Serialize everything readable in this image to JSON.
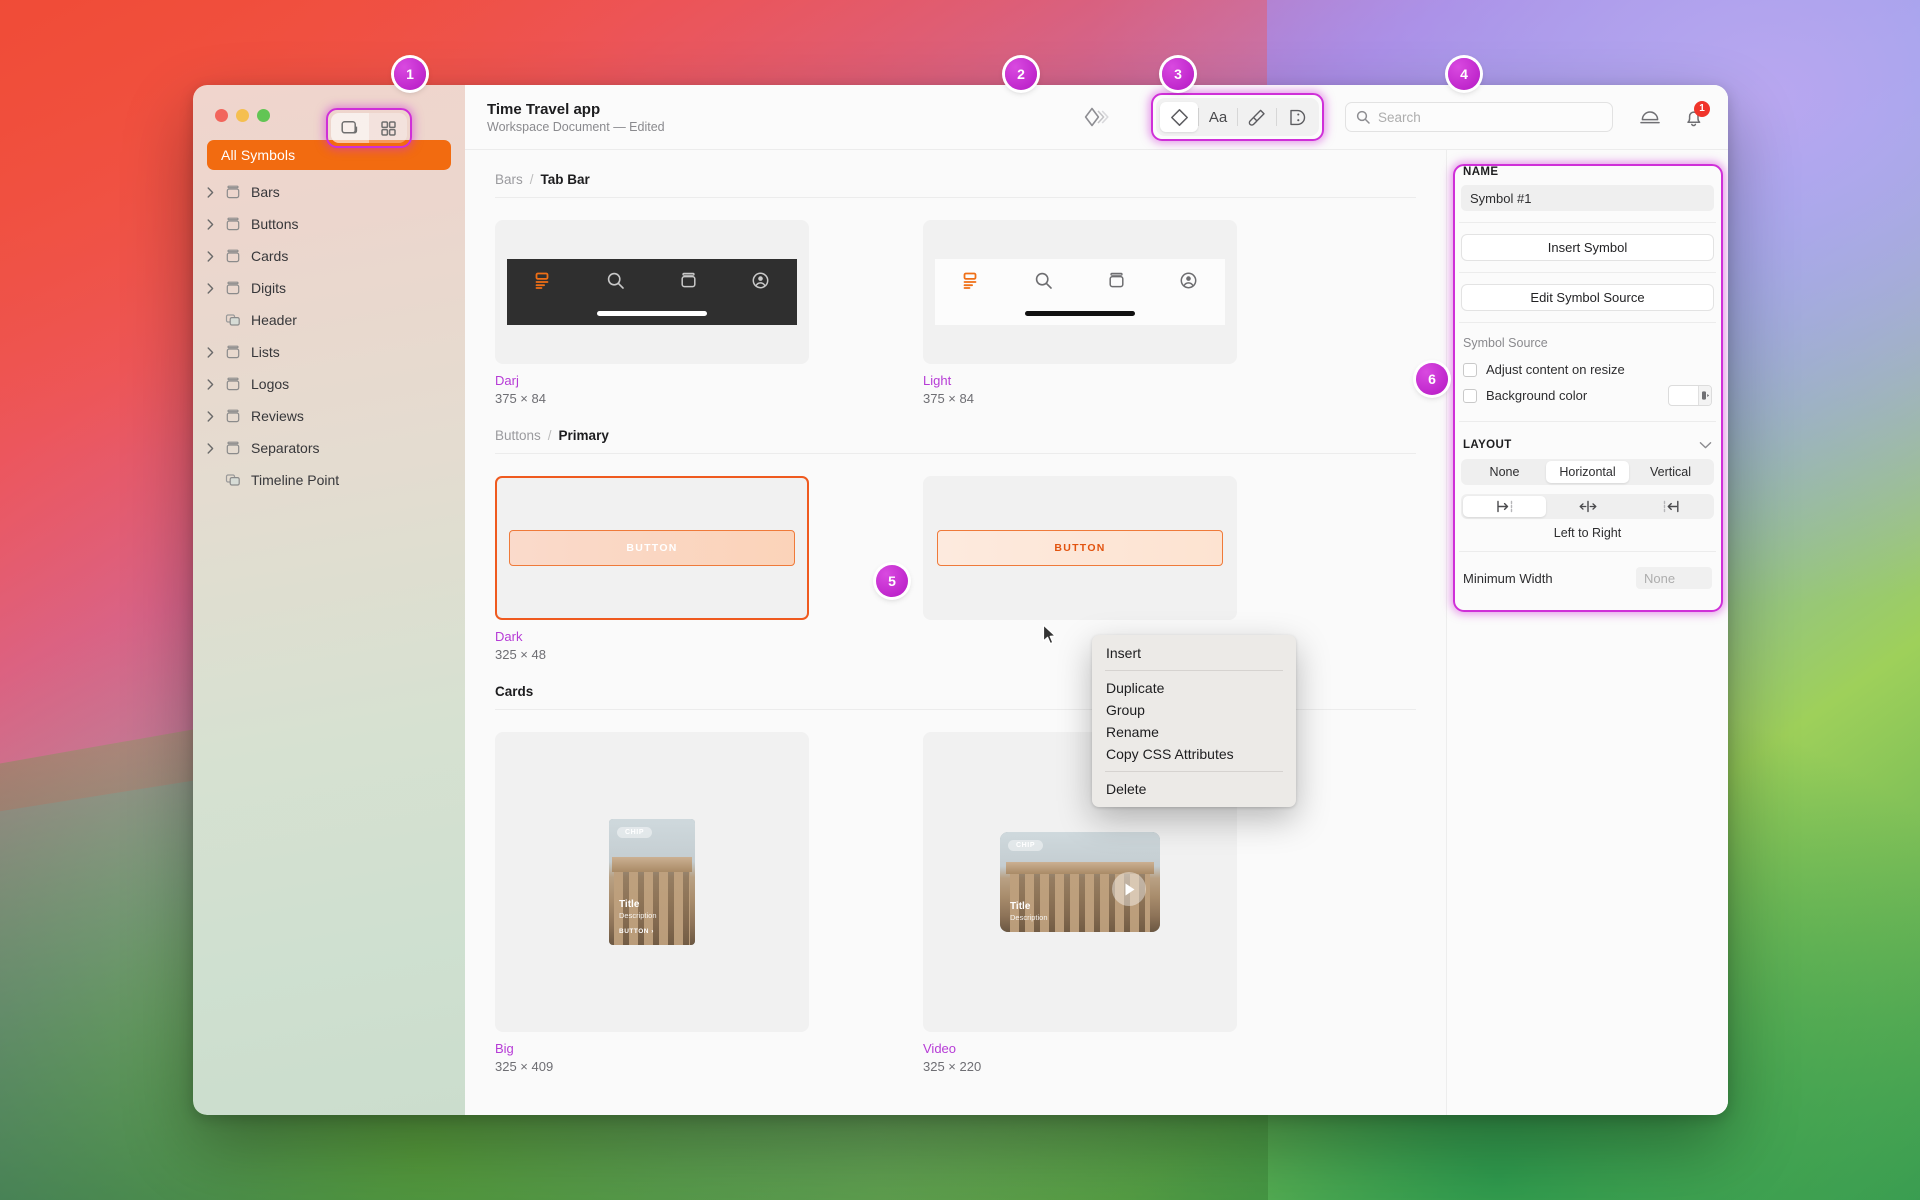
{
  "window": {
    "traffic_lights": [
      "close",
      "minimize",
      "zoom"
    ],
    "view_toggle": {
      "single_label": "single-view",
      "grid_label": "grid-view"
    }
  },
  "sidebar": {
    "all_symbols_label": "All Symbols",
    "items": [
      {
        "label": "Bars",
        "expandable": true,
        "icon": "library-icon"
      },
      {
        "label": "Buttons",
        "expandable": true,
        "icon": "library-icon"
      },
      {
        "label": "Cards",
        "expandable": true,
        "icon": "library-icon"
      },
      {
        "label": "Digits",
        "expandable": true,
        "icon": "library-icon"
      },
      {
        "label": "Header",
        "expandable": false,
        "icon": "symbol-icon"
      },
      {
        "label": "Lists",
        "expandable": true,
        "icon": "library-icon"
      },
      {
        "label": "Logos",
        "expandable": true,
        "icon": "library-icon"
      },
      {
        "label": "Reviews",
        "expandable": true,
        "icon": "library-icon"
      },
      {
        "label": "Separators",
        "expandable": true,
        "icon": "library-icon"
      },
      {
        "label": "Timeline Point",
        "expandable": false,
        "icon": "symbol-icon"
      }
    ]
  },
  "toolbar": {
    "doc_title": "Time Travel app",
    "doc_subtitle": "Workspace Document — Edited",
    "symbol_export_icon": "symbol-export-icon",
    "inspector_tabs": [
      {
        "name": "symbol-tab",
        "icon": "diamond-icon",
        "active": true
      },
      {
        "name": "text-tab",
        "icon": "text-aa-icon",
        "label": "Aa",
        "active": false
      },
      {
        "name": "style-tab",
        "icon": "paintbrush-icon",
        "active": false
      },
      {
        "name": "palette-tab",
        "icon": "color-palette-icon",
        "active": false
      }
    ],
    "search": {
      "placeholder": "Search",
      "value": ""
    },
    "share_icon": "share-dome-icon",
    "notifications": {
      "icon": "bell-icon",
      "count": "1"
    }
  },
  "canvas": {
    "sections": [
      {
        "breadcrumb": {
          "parent": "Bars",
          "separator": "/",
          "current": "Tab Bar"
        },
        "items": [
          {
            "name": "Darj",
            "size": "375 × 84",
            "kind": "tabbar",
            "theme": "dark",
            "tab_icons": [
              "dashboard-icon",
              "search-icon",
              "archive-icon",
              "account-icon"
            ],
            "active_tab_index": 0
          },
          {
            "name": "Light",
            "size": "375 × 84",
            "kind": "tabbar",
            "theme": "light",
            "tab_icons": [
              "dashboard-icon",
              "search-icon",
              "archive-icon",
              "account-icon"
            ],
            "active_tab_index": 0
          }
        ]
      },
      {
        "breadcrumb": {
          "parent": "Buttons",
          "separator": "/",
          "current": "Primary"
        },
        "items": [
          {
            "name": "Dark",
            "size": "325 × 48",
            "kind": "button",
            "style": "filled",
            "button_label": "Button",
            "selected": true
          },
          {
            "name": "",
            "size": "",
            "kind": "button",
            "style": "outline",
            "button_label": "Button",
            "selected": false
          }
        ]
      },
      {
        "title": "Cards",
        "items": [
          {
            "name": "Big",
            "size": "325 × 409",
            "kind": "card",
            "variant": "big",
            "chip": "CHIP",
            "card_title": "Title",
            "card_desc": "Description",
            "card_button": "Button"
          },
          {
            "name": "Video",
            "size": "325 × 220",
            "kind": "card",
            "variant": "video",
            "chip": "CHIP",
            "card_title": "Title",
            "card_desc": "Description",
            "play_icon": "play-icon"
          }
        ]
      }
    ]
  },
  "context_menu": {
    "groups": [
      [
        "Insert"
      ],
      [
        "Duplicate",
        "Group",
        "Rename",
        "Copy CSS Attributes"
      ],
      [
        "Delete"
      ]
    ]
  },
  "inspector": {
    "name_header": "NAME",
    "name_value": "Symbol #1",
    "insert_symbol_label": "Insert Symbol",
    "edit_symbol_source_label": "Edit Symbol Source",
    "symbol_source_label": "Symbol Source",
    "adjust_content_label": "Adjust content on resize",
    "adjust_content_checked": false,
    "background_color_label": "Background color",
    "background_color_checked": false,
    "background_color_value": "#ffffff",
    "layout_header": "LAYOUT",
    "layout_collapse_icon": "chevron-down-icon",
    "layout_options": [
      "None",
      "Horizontal",
      "Vertical"
    ],
    "layout_selected": "Horizontal",
    "alignment_options": [
      "align-left-icon",
      "align-center-icon",
      "align-right-icon"
    ],
    "alignment_selected_index": 0,
    "alignment_caption": "Left to Right",
    "minimum_width_label": "Minimum Width",
    "minimum_width_value": "None"
  },
  "callouts": [
    {
      "number": "1"
    },
    {
      "number": "2"
    },
    {
      "number": "3"
    },
    {
      "number": "4"
    },
    {
      "number": "5"
    },
    {
      "number": "6"
    }
  ],
  "colors": {
    "accent_orange": "#f26b10",
    "highlight_magenta": "#cf2fd8",
    "symbol_name_purple": "#b63bd6",
    "badge_red": "#f0342a"
  }
}
